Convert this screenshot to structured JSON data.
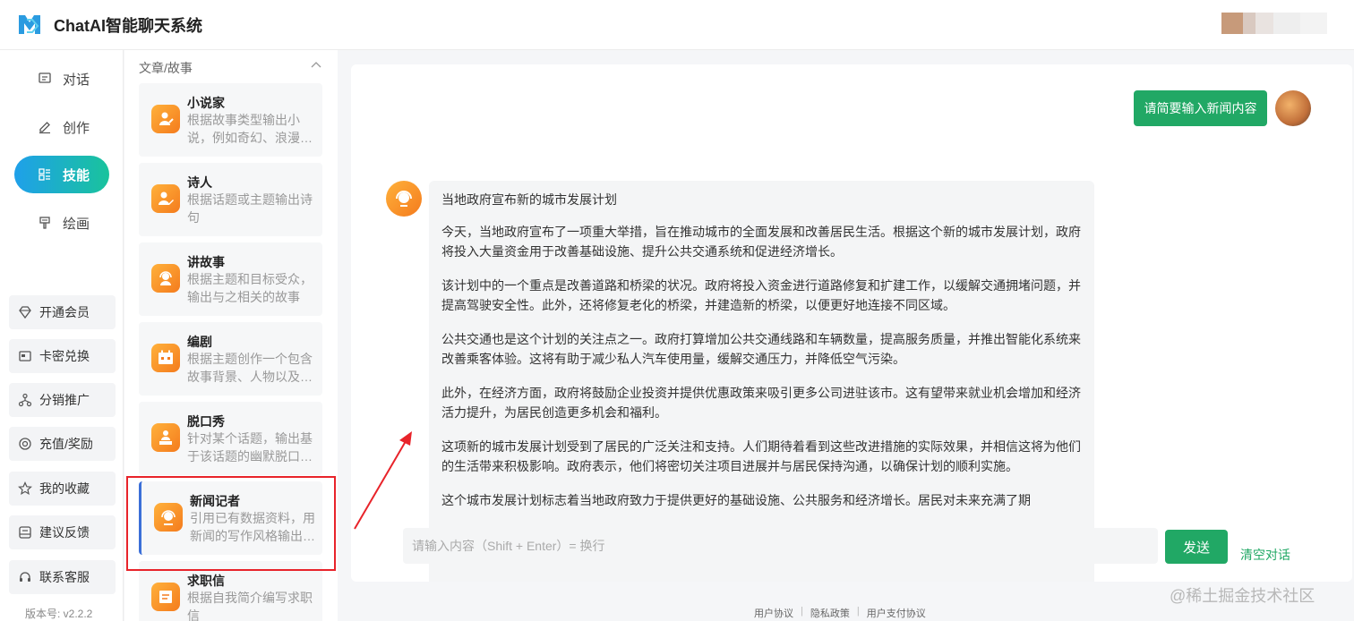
{
  "header": {
    "brand": "ChatAI智能聊天系统"
  },
  "nav": {
    "items": [
      {
        "label": "对话",
        "icon": "chat-icon"
      },
      {
        "label": "创作",
        "icon": "pen-icon"
      },
      {
        "label": "技能",
        "icon": "skills-icon",
        "active": true
      },
      {
        "label": "绘画",
        "icon": "brush-icon"
      }
    ],
    "buttons": [
      {
        "label": "开通会员",
        "icon": "diamond-icon"
      },
      {
        "label": "卡密兑换",
        "icon": "card-icon"
      },
      {
        "label": "分销推广",
        "icon": "share-icon"
      },
      {
        "label": "充值/奖励",
        "icon": "coin-icon"
      },
      {
        "label": "我的收藏",
        "icon": "star-icon"
      },
      {
        "label": "建议反馈",
        "icon": "feedback-icon"
      },
      {
        "label": "联系客服",
        "icon": "headset-icon"
      }
    ],
    "version": "版本号: v2.2.2"
  },
  "skills": {
    "category": "文章/故事",
    "cards": [
      {
        "title": "小说家",
        "desc": "根据故事类型输出小说，例如奇幻、浪漫…"
      },
      {
        "title": "诗人",
        "desc": "根据话题或主题输出诗句"
      },
      {
        "title": "讲故事",
        "desc": "根据主题和目标受众，输出与之相关的故事"
      },
      {
        "title": "编剧",
        "desc": "根据主题创作一个包含故事背景、人物以及…"
      },
      {
        "title": "脱口秀",
        "desc": "针对某个话题，输出基于该话题的幽默脱口…"
      },
      {
        "title": "新闻记者",
        "desc": "引用已有数据资料，用新闻的写作风格输出…"
      },
      {
        "title": "求职信",
        "desc": "根据自我简介编写求职信"
      }
    ]
  },
  "chat": {
    "user_message": "请简要输入新闻内容",
    "bot_paragraphs": [
      "当地政府宣布新的城市发展计划",
      "今天，当地政府宣布了一项重大举措，旨在推动城市的全面发展和改善居民生活。根据这个新的城市发展计划，政府将投入大量资金用于改善基础设施、提升公共交通系统和促进经济增长。",
      "该计划中的一个重点是改善道路和桥梁的状况。政府将投入资金进行道路修复和扩建工作，以缓解交通拥堵问题，并提高驾驶安全性。此外，还将修复老化的桥梁，并建造新的桥梁，以便更好地连接不同区域。",
      "公共交通也是这个计划的关注点之一。政府打算增加公共交通线路和车辆数量，提高服务质量，并推出智能化系统来改善乘客体验。这将有助于减少私人汽车使用量，缓解交通压力，并降低空气污染。",
      "此外，在经济方面，政府将鼓励企业投资并提供优惠政策来吸引更多公司进驻该市。这有望带来就业机会增加和经济活力提升，为居民创造更多机会和福利。",
      "这项新的城市发展计划受到了居民的广泛关注和支持。人们期待着看到这些改进措施的实际效果，并相信这将为他们的生活带来积极影响。政府表示，他们将密切关注项目进展并与居民保持沟通，以确保计划的顺利实施。",
      "这个城市发展计划标志着当地政府致力于提供更好的基础设施、公共服务和经济增长。居民对未来充满了期"
    ],
    "input_placeholder": "请输入内容（Shift + Enter）= 换行",
    "input_value": "",
    "send_label": "发送",
    "clear_label": "清空对话"
  },
  "footer": {
    "links": [
      "用户协议",
      "隐私政策",
      "用户支付协议"
    ],
    "separator": "|"
  },
  "watermark": "@稀土掘金技术社区",
  "colors": {
    "accent_green": "#21a865",
    "nav_gradient_start": "#1fa0ea",
    "nav_gradient_end": "#19c39c",
    "icon_orange": "#f47b1d",
    "highlight_red": "#e8232a"
  }
}
